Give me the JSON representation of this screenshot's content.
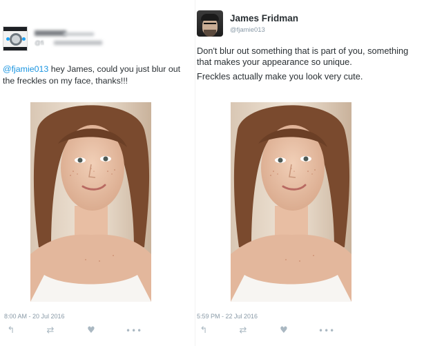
{
  "left_tweet": {
    "author_name": "",
    "author_handle": "@fi",
    "mention": "@fjamie013",
    "text": " hey James, could you just blur out the freckles on my face, thanks!!!",
    "timestamp": "8:00 AM - 20 Jul 2016",
    "actions": {
      "reply_icon": "↰",
      "retweet_icon": "⇄",
      "like_icon": "♥",
      "more_icon": "•••"
    }
  },
  "right_tweet": {
    "author_name": "James Fridman",
    "author_handle": "@fjamie013",
    "paragraphs": [
      "Don't blur out something that is part of you, something that makes your appearance so unique.",
      "Freckles actually make you look very cute."
    ],
    "timestamp": "5:59 PM - 22 Jul 2016",
    "actions": {
      "reply_icon": "↰",
      "retweet_icon": "⇄",
      "like_icon": "♥",
      "more_icon": "•••"
    }
  },
  "colors": {
    "mention": "#1b95e0",
    "text": "#292f33",
    "meta": "#8899a6",
    "action_icon": "#aab8c2"
  }
}
